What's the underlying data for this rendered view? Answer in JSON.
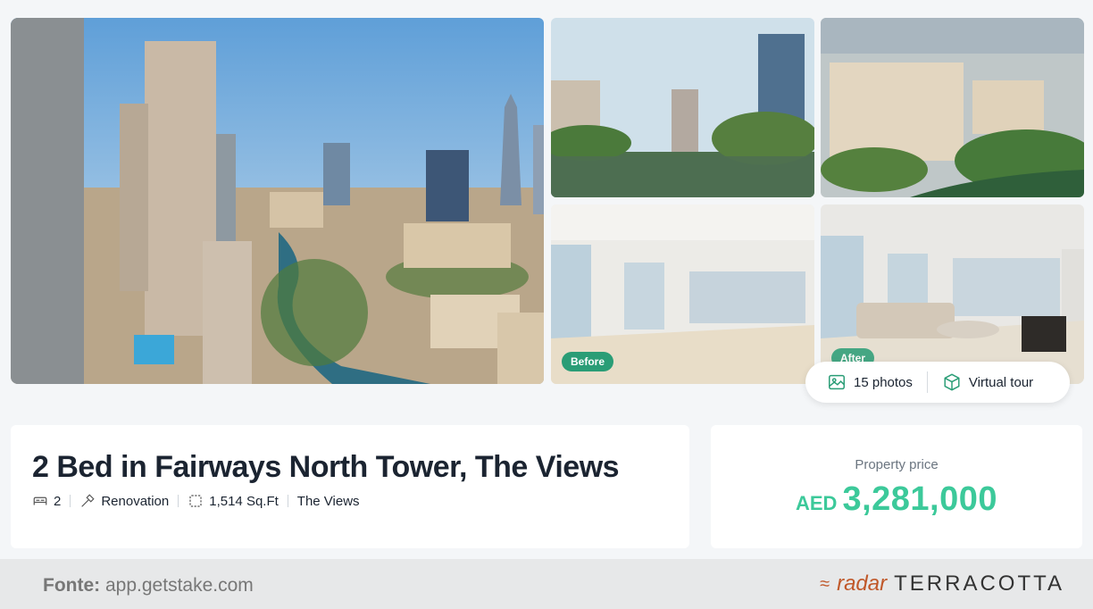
{
  "gallery": {
    "badges": {
      "before": "Before",
      "after": "After"
    },
    "media": {
      "photos_label": "15 photos",
      "tour_label": "Virtual tour"
    }
  },
  "listing": {
    "title": "2 Bed in Fairways North Tower, The Views",
    "features": {
      "bedrooms": "2",
      "status": "Renovation",
      "area": "1,514 Sq.Ft",
      "community": "The Views"
    }
  },
  "price": {
    "label": "Property price",
    "currency": "AED",
    "amount": "3,281,000"
  },
  "footer": {
    "source_label": "Fonte:",
    "source_url": "app.getstake.com",
    "brand_radar": "radar",
    "brand_name": "TERRACOTTA"
  },
  "colors": {
    "accent_green": "#3cc99a",
    "badge_green": "#2a9d76",
    "brand_orange": "#c0582a"
  },
  "icons": [
    "image-icon",
    "cube-icon",
    "bed-icon",
    "hammer-icon",
    "area-icon",
    "radar-logo-icon"
  ]
}
